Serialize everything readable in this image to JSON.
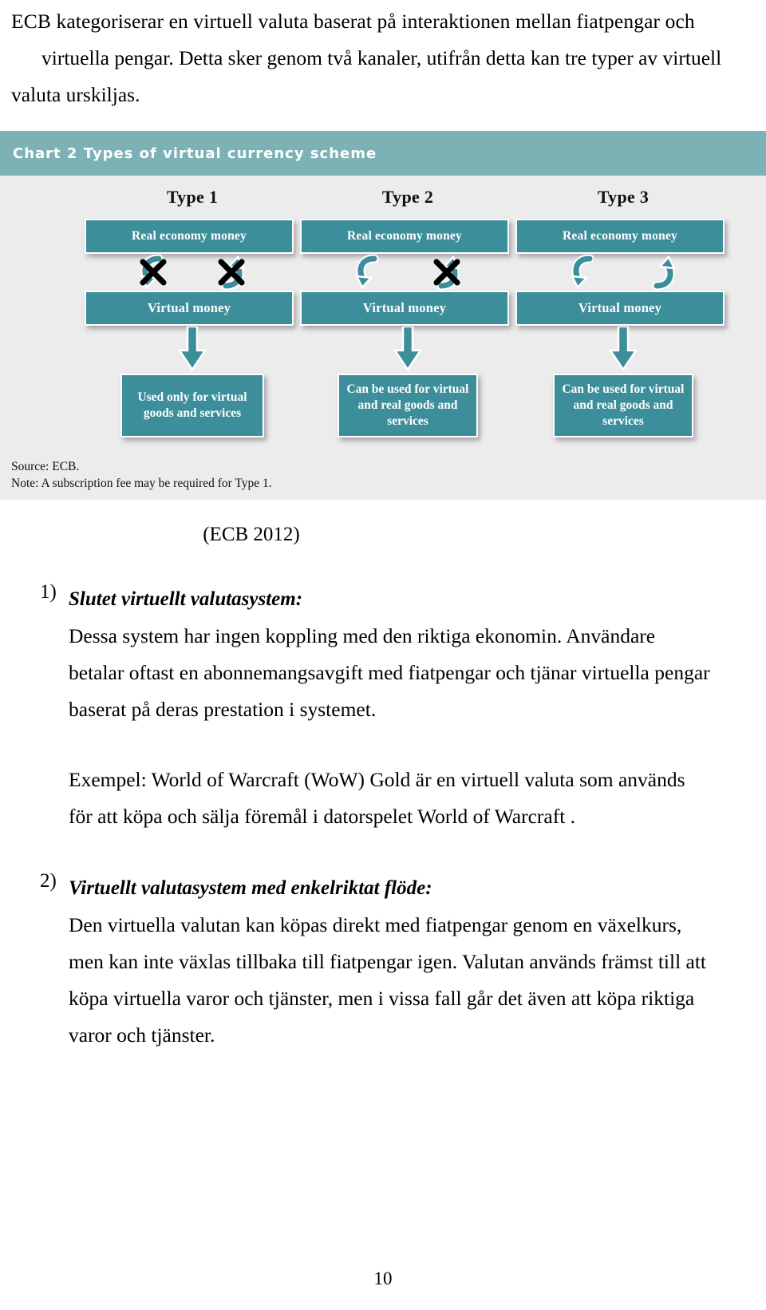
{
  "document": {
    "page_number": "10",
    "intro_paragraph": {
      "line1": "ECB kategoriserar en virtuell valuta baserat på interaktionen mellan fiatpengar och",
      "line2": "virtuella pengar. Detta sker genom två kanaler, utifrån detta kan tre typer av virtuell",
      "line3": "valuta urskiljas."
    },
    "citation": "(ECB 2012)"
  },
  "chart": {
    "header_title": "Chart 2 Types of virtual currency scheme",
    "header_color": "#7cb2b6",
    "box_color": "#3d8e9b",
    "background_color": "#ececed",
    "columns": [
      {
        "type_label": "Type 1",
        "top_box": "Real economy money",
        "mid_box": "Virtual money",
        "bottom_box": "Used only for virtual goods and services",
        "left_arrow": {
          "icon": "curved-arrow-down-icon",
          "crossed": true
        },
        "right_arrow": {
          "icon": "curved-arrow-up-icon",
          "crossed": true
        }
      },
      {
        "type_label": "Type 2",
        "top_box": "Real economy money",
        "mid_box": "Virtual money",
        "bottom_box": "Can be used for virtual and  real goods and services",
        "left_arrow": {
          "icon": "curved-arrow-down-icon",
          "crossed": false
        },
        "right_arrow": {
          "icon": "curved-arrow-up-icon",
          "crossed": true
        }
      },
      {
        "type_label": "Type 3",
        "top_box": "Real economy money",
        "mid_box": "Virtual money",
        "bottom_box": "Can be used for virtual and  real goods and services",
        "left_arrow": {
          "icon": "curved-arrow-down-icon",
          "crossed": false
        },
        "right_arrow": {
          "icon": "curved-arrow-up-icon",
          "crossed": false
        }
      }
    ],
    "source_line": "Source: ECB.",
    "note_line": "Note: A subscription fee may be required for Type 1."
  },
  "sections": [
    {
      "marker": "1)",
      "title": "Slutet virtuellt valutasystem:",
      "paragraph_1": {
        "line1": "Dessa system har ingen koppling med den riktiga ekonomin. Användare",
        "line2": "betalar oftast en abonnemangsavgift med fiatpengar och tjänar virtuella pengar",
        "line3": "baserat på deras prestation i systemet."
      },
      "paragraph_2": {
        "line1": "Exempel: World of Warcraft (WoW) Gold är en virtuell valuta som används",
        "line2": "för att köpa och sälja föremål i datorspelet World of Warcraft  ."
      }
    },
    {
      "marker": "2)",
      "title": "Virtuellt valutasystem med enkelriktat flöde:",
      "paragraph_1": {
        "line1": "Den virtuella valutan kan köpas direkt med fiatpengar genom en växelkurs,",
        "line2": "men kan inte växlas tillbaka till fiatpengar igen. Valutan används främst till att",
        "line3": "köpa virtuella varor och tjänster, men i vissa fall går det även att köpa riktiga",
        "line4": "varor och tjänster."
      }
    }
  ]
}
